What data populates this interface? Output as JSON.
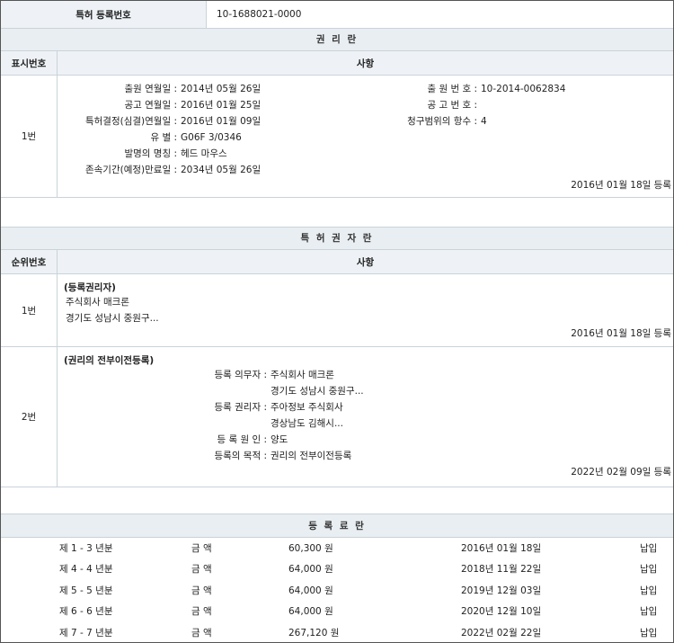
{
  "reg_number": {
    "label": "특허 등록번호",
    "value": "10-1688021-0000"
  },
  "rights": {
    "title": "권 리 란",
    "col_index": "표시번호",
    "col_content": "사항",
    "row_index": "1번",
    "fields_left": [
      {
        "label": "출원 연월일 :",
        "value": "2014년 05월 26일"
      },
      {
        "label": "공고 연월일 :",
        "value": "2016년 01월 25일"
      },
      {
        "label": "특허결정(심결)연월일 :",
        "value": "2016년 01월 09일"
      },
      {
        "label": "유 별 :",
        "value": "G06F 3/0346"
      },
      {
        "label": "발명의 명칭 :",
        "value": "헤드 마우스"
      },
      {
        "label": "존속기간(예정)만료일 :",
        "value": "2034년 05월 26일"
      }
    ],
    "fields_right": [
      {
        "label": "출 원 번 호 :",
        "value": "10-2014-0062834"
      },
      {
        "label": "공 고 번 호 :",
        "value": ""
      },
      {
        "label": "청구범위의 항수 :",
        "value": "4"
      }
    ],
    "registered": "2016년 01월 18일 등록"
  },
  "holders": {
    "title": "특 허 권 자 란",
    "col_index": "순위번호",
    "col_content": "사항",
    "entry1": {
      "index": "1번",
      "heading": "(등록권리자)",
      "name": "주식회사 매크론",
      "address": "경기도 성남시 중원구...",
      "registered": "2016년 01월 18일 등록"
    },
    "entry2": {
      "index": "2번",
      "heading": "(권리의 전부이전등록)",
      "fields": [
        {
          "label": "등록 의무자 :",
          "value": "주식회사 매크론"
        },
        {
          "label": "",
          "value": "경기도 성남시 중원구..."
        },
        {
          "label": "등록 권리자 :",
          "value": "주아정보 주식회사"
        },
        {
          "label": "",
          "value": "경상남도 김해시..."
        },
        {
          "label": "등 록 원 인 :",
          "value": "양도"
        },
        {
          "label": "등록의 목적 :",
          "value": "권리의 전부이전등록"
        }
      ],
      "registered": "2022년 02월 09일 등록"
    }
  },
  "fees": {
    "title": "등 록 료 란",
    "rows": [
      {
        "period": "제 1 - 3 년분",
        "amount_label": "금 액",
        "amount": "60,300 원",
        "date": "2016년 01월 18일",
        "status": "납입"
      },
      {
        "period": "제 4 - 4 년분",
        "amount_label": "금 액",
        "amount": "64,000 원",
        "date": "2018년 11월 22일",
        "status": "납입"
      },
      {
        "period": "제 5 - 5 년분",
        "amount_label": "금 액",
        "amount": "64,000 원",
        "date": "2019년 12월 03일",
        "status": "납입"
      },
      {
        "period": "제 6 - 6 년분",
        "amount_label": "금 액",
        "amount": "64,000 원",
        "date": "2020년 12월 10일",
        "status": "납입"
      },
      {
        "period": "제 7 - 7 년분",
        "amount_label": "금 액",
        "amount": "267,120 원",
        "date": "2022년 02월 22일",
        "status": "납입"
      }
    ]
  }
}
